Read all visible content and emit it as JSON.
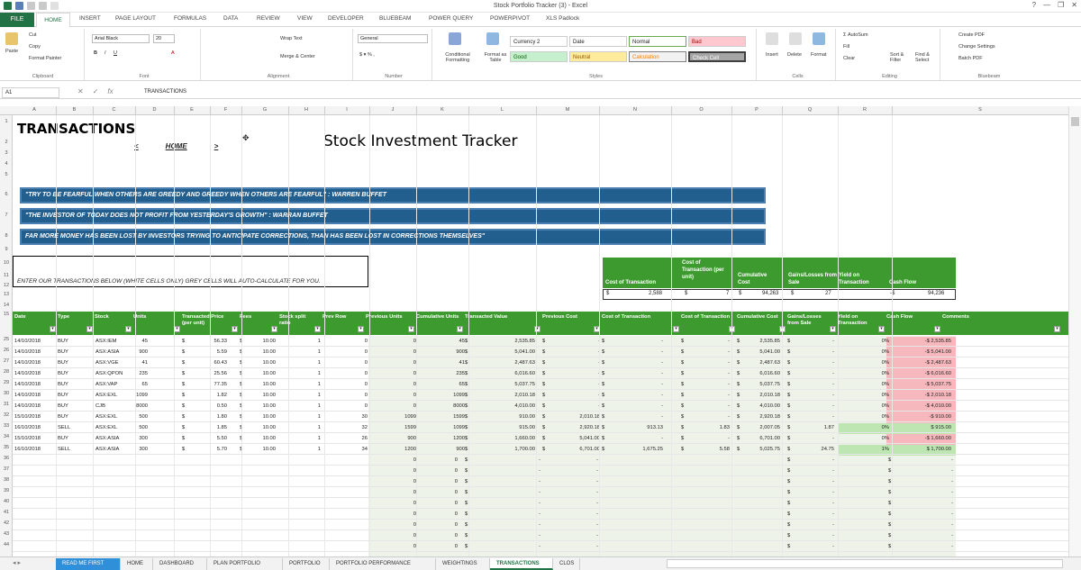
{
  "app": {
    "title": "Stock Portfolio Tracker (3) - Excel",
    "window_controls": [
      "?",
      "—",
      "❐",
      "✕"
    ]
  },
  "colors": {
    "excel_green": "#217346",
    "table_green": "#3d9a2f",
    "quote_blue": "#225e8e",
    "red_fill": "#f6b8bc",
    "green_fill": "#bde6b3"
  },
  "ribbon_tabs": [
    "FILE",
    "HOME",
    "INSERT",
    "PAGE LAYOUT",
    "FORMULAS",
    "DATA",
    "REVIEW",
    "VIEW",
    "DEVELOPER",
    "BLUEBEAM",
    "POWER QUERY",
    "POWERPIVOT",
    "XLS Padlock"
  ],
  "ribbon": {
    "clipboard": {
      "label": "Clipboard",
      "paste": "Paste",
      "cut": "Cut",
      "copy": "Copy",
      "format_painter": "Format Painter"
    },
    "font": {
      "label": "Font",
      "name": "Arial Black",
      "size": "20"
    },
    "alignment": {
      "label": "Alignment",
      "wrap": "Wrap Text",
      "merge": "Merge & Center"
    },
    "number": {
      "label": "Number",
      "format": "General"
    },
    "styles": {
      "label": "Styles",
      "conditional": "Conditional Formatting",
      "format_table": "Format as Table",
      "items": [
        "Currency 2",
        "Date",
        "Normal",
        "Bad",
        "Good",
        "Neutral",
        "Calculation",
        "Check Cell"
      ]
    },
    "cells": {
      "label": "Cells",
      "insert": "Insert",
      "delete": "Delete",
      "format": "Format"
    },
    "editing": {
      "label": "Editing",
      "autosum": "AutoSum",
      "fill": "Fill",
      "clear": "Clear",
      "sort": "Sort & Filter",
      "find": "Find & Select"
    },
    "bluebeam": {
      "label": "Bluebeam",
      "create": "Create PDF",
      "change": "Change Settings",
      "batch": "Batch PDF"
    }
  },
  "formula_bar": {
    "name_box": "A1",
    "formula": "TRANSACTIONS"
  },
  "columns": [
    "A",
    "B",
    "C",
    "D",
    "E",
    "F",
    "G",
    "H",
    "I",
    "J",
    "K",
    "L",
    "M",
    "N",
    "O",
    "P",
    "Q",
    "R",
    "S"
  ],
  "row_numbers": [
    "1",
    "2",
    "3",
    "4",
    "5",
    "6",
    "7",
    "8",
    "9",
    "10",
    "11",
    "12",
    "13",
    "14",
    "15",
    "25",
    "26",
    "27",
    "28",
    "29",
    "30",
    "31",
    "32",
    "33",
    "34",
    "35",
    "36",
    "37",
    "38",
    "39",
    "40",
    "41",
    "42",
    "43",
    "44"
  ],
  "sheet": {
    "title": "TRANSACTIONS",
    "nav_prev": "<",
    "nav_home": "HOME",
    "nav_next": ">",
    "tracker_title": "Stock Investment Tracker",
    "quotes": [
      "\"TRY TO BE FEARFUL WHEN OTHERS ARE GREEDY AND GREEDY WHEN OTHERS ARE FEARFUL\" : WARREN BUFFET",
      "\"THE INVESTOR OF TODAY DOES NOT PROFIT FROM YESTERDAY'S GROWTH\" : WARRAN BUFFET",
      "FAR MORE MONEY HAS BEEN LOST BY INVESTORS TRYING TO ANTICIPATE CORRECTIONS, THAN HAS BEEN LOST IN CORRECTIONS THEMSELVES\""
    ],
    "instruction": "ENTER OUR TRANSACTIONS BELOW (WHITE CELLS ONLY) GREY CELLS WILL AUTO-CALCULATE FOR YOU.",
    "summary": {
      "headers": [
        "Cost of Transaction",
        "Cost of Transaction (per unit)",
        "Cumulative Cost",
        "Gains/Losses from Sale",
        "Yield on Transaction",
        "Cash Flow"
      ],
      "values": [
        "2,588",
        "7",
        "94,263",
        "27",
        "",
        "94,236"
      ],
      "currency": "$",
      "cash_prefix": "-$"
    },
    "table_headers": [
      "Date",
      "Type",
      "Stock",
      "Units",
      "Transacted Price (per unit)",
      "Fees",
      "Stock split ratio",
      "Prev Row",
      "Previous Units",
      "Cumulative Units",
      "Transacted Value",
      "Previous Cost",
      "Cost of Transaction",
      "Cost of Transaction",
      "Cumulative Cost",
      "Gains/Losses from Sale",
      "Yield on Transaction",
      "Cash Flow",
      "Comments"
    ],
    "rows": [
      {
        "date": "14/10/2018",
        "type": "BUY",
        "stock": "ASX:IEM",
        "units": "45",
        "price": "56.33",
        "fees": "10.00",
        "split": "1",
        "prev": "0",
        "prevu": "0",
        "cumu": "45",
        "val": "2,535.85",
        "pc": "-",
        "ct": "-",
        "ctu": "-",
        "cc": "2,535.85",
        "gl": "-",
        "yld": "0%",
        "cf": "-$ 2,535.85",
        "cf_type": "neg"
      },
      {
        "date": "14/10/2018",
        "type": "BUY",
        "stock": "ASX:ASIA",
        "units": "900",
        "price": "5.59",
        "fees": "10.00",
        "split": "1",
        "prev": "0",
        "prevu": "0",
        "cumu": "900",
        "val": "5,041.00",
        "pc": "-",
        "ct": "-",
        "ctu": "-",
        "cc": "5,041.00",
        "gl": "-",
        "yld": "0%",
        "cf": "-$ 5,041.00",
        "cf_type": "neg"
      },
      {
        "date": "14/10/2018",
        "type": "BUY",
        "stock": "ASX:VGE",
        "units": "41",
        "price": "60.43",
        "fees": "10.00",
        "split": "1",
        "prev": "0",
        "prevu": "0",
        "cumu": "41",
        "val": "2,487.63",
        "pc": "-",
        "ct": "-",
        "ctu": "-",
        "cc": "2,487.63",
        "gl": "-",
        "yld": "0%",
        "cf": "-$ 2,487.63",
        "cf_type": "neg"
      },
      {
        "date": "14/10/2018",
        "type": "BUY",
        "stock": "ASX:QPON",
        "units": "235",
        "price": "25.56",
        "fees": "10.00",
        "split": "1",
        "prev": "0",
        "prevu": "0",
        "cumu": "235",
        "val": "6,016.60",
        "pc": "-",
        "ct": "-",
        "ctu": "-",
        "cc": "6,016.60",
        "gl": "-",
        "yld": "0%",
        "cf": "-$ 6,016.60",
        "cf_type": "neg"
      },
      {
        "date": "14/10/2018",
        "type": "BUY",
        "stock": "ASX:VAP",
        "units": "65",
        "price": "77.35",
        "fees": "10.00",
        "split": "1",
        "prev": "0",
        "prevu": "0",
        "cumu": "65",
        "val": "5,037.75",
        "pc": "-",
        "ct": "-",
        "ctu": "-",
        "cc": "5,037.75",
        "gl": "-",
        "yld": "0%",
        "cf": "-$ 5,037.75",
        "cf_type": "neg"
      },
      {
        "date": "14/10/2018",
        "type": "BUY",
        "stock": "ASX:EXL",
        "units": "1099",
        "price": "1.82",
        "fees": "10.00",
        "split": "1",
        "prev": "0",
        "prevu": "0",
        "cumu": "1099",
        "val": "2,010.18",
        "pc": "-",
        "ct": "-",
        "ctu": "-",
        "cc": "2,010.18",
        "gl": "-",
        "yld": "0%",
        "cf": "-$ 2,010.18",
        "cf_type": "neg"
      },
      {
        "date": "14/10/2018",
        "type": "BUY",
        "stock": "CJB",
        "units": "8000",
        "price": "0.50",
        "fees": "10.00",
        "split": "1",
        "prev": "0",
        "prevu": "0",
        "cumu": "8000",
        "val": "4,010.00",
        "pc": "-",
        "ct": "-",
        "ctu": "-",
        "cc": "4,010.00",
        "gl": "-",
        "yld": "0%",
        "cf": "-$ 4,010.00",
        "cf_type": "neg"
      },
      {
        "date": "15/10/2018",
        "type": "BUY",
        "stock": "ASX:EXL",
        "units": "500",
        "price": "1.80",
        "fees": "10.00",
        "split": "1",
        "prev": "30",
        "prevu": "1099",
        "cumu": "1599",
        "val": "910.00",
        "pc": "2,010.18",
        "ct": "-",
        "ctu": "-",
        "cc": "2,920.18",
        "gl": "-",
        "yld": "0%",
        "cf": "-$ 910.00",
        "cf_type": "neg"
      },
      {
        "date": "16/10/2018",
        "type": "SELL",
        "stock": "ASX:EXL",
        "units": "500",
        "price": "1.85",
        "fees": "10.00",
        "split": "1",
        "prev": "32",
        "prevu": "1599",
        "cumu": "1099",
        "val": "915.00",
        "pc": "2,920.18",
        "ct": "913.13",
        "ctu": "1.83",
        "cc": "2,007.05",
        "gl": "1.87",
        "yld": "0%",
        "cf": "$ 915.00",
        "cf_type": "pos"
      },
      {
        "date": "15/10/2018",
        "type": "BUY",
        "stock": "ASX:ASIA",
        "units": "300",
        "price": "5.50",
        "fees": "10.00",
        "split": "1",
        "prev": "26",
        "prevu": "900",
        "cumu": "1200",
        "val": "1,660.00",
        "pc": "5,041.00",
        "ct": "-",
        "ctu": "-",
        "cc": "6,701.00",
        "gl": "-",
        "yld": "0%",
        "cf": "-$ 1,660.00",
        "cf_type": "neg"
      },
      {
        "date": "16/10/2018",
        "type": "SELL",
        "stock": "ASX:ASIA",
        "units": "300",
        "price": "5.70",
        "fees": "10.00",
        "split": "1",
        "prev": "34",
        "prevu": "1200",
        "cumu": "900",
        "val": "1,700.00",
        "pc": "6,701.00",
        "ct": "1,675.25",
        "ctu": "5.58",
        "cc": "5,025.75",
        "gl": "24.75",
        "yld": "1%",
        "cf": "$ 1,700.00",
        "cf_type": "pos"
      }
    ],
    "empty_row": {
      "prevu": "0",
      "cumu": "0",
      "val": "-",
      "dollar": "$",
      "dash": "-"
    }
  },
  "sheet_tabs": [
    "READ ME FIRST",
    "HOME",
    "DASHBOARD",
    "PLAN PORTFOLIO",
    "PORTFOLIO",
    "PORTFOLIO PERFORMANCE",
    "WEIGHTINGS",
    "TRANSACTIONS",
    "CLOS"
  ],
  "active_sheet": "TRANSACTIONS"
}
